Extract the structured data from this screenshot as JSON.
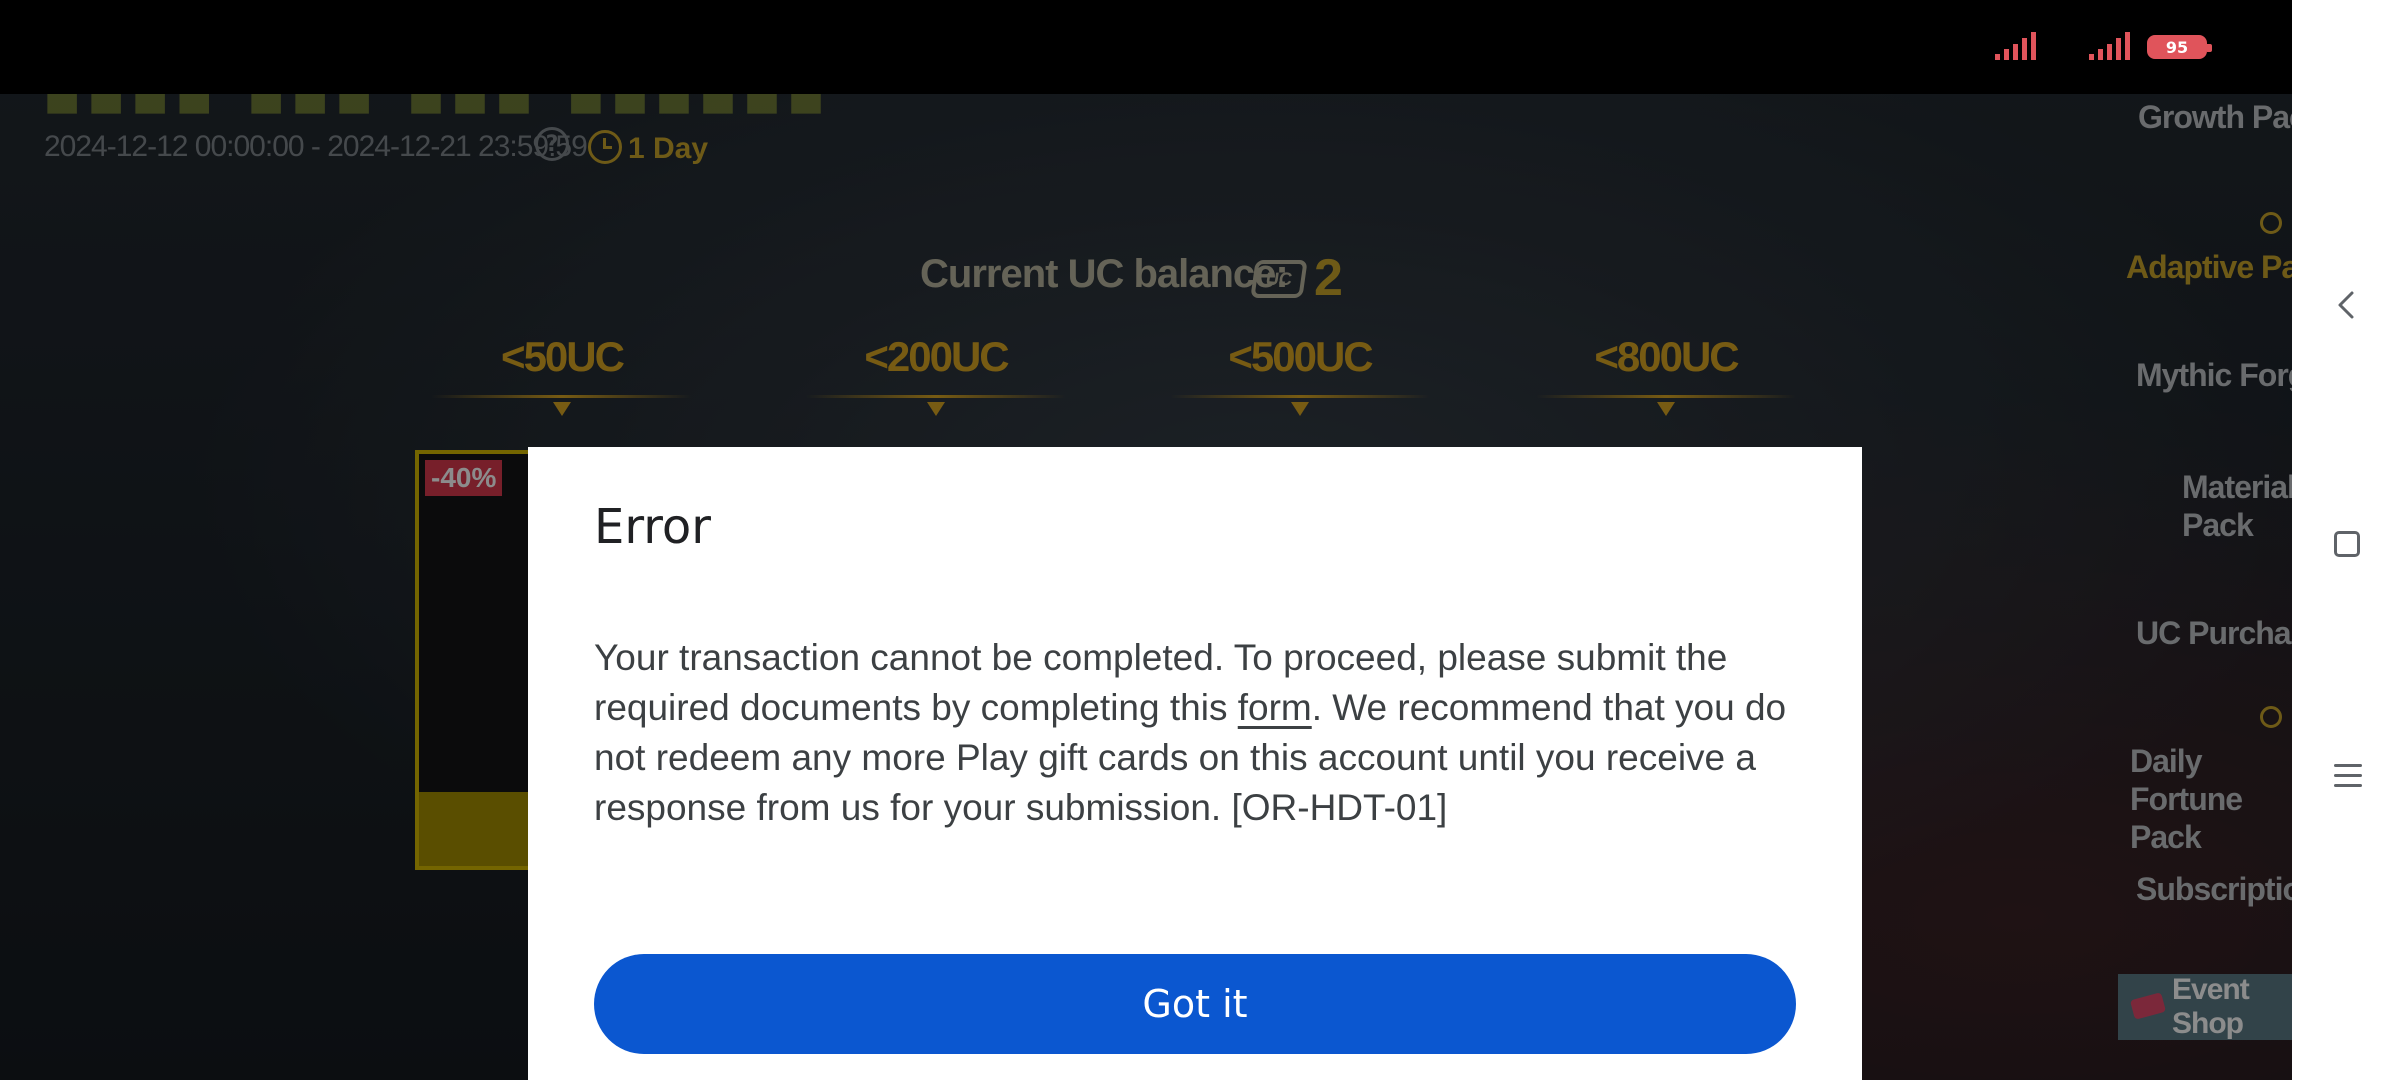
{
  "status_bar": {
    "battery": "95"
  },
  "event": {
    "dates": "2024-12-12 00:00:00 - 2024-12-21 23:59:59",
    "duration": "1 Day",
    "help_symbol": "?"
  },
  "balance": {
    "label": "Current UC balance:",
    "currency_icon": "UC",
    "value": "2"
  },
  "tiers": [
    {
      "label": "<50UC"
    },
    {
      "label": "<200UC"
    },
    {
      "label": "<500UC"
    },
    {
      "label": "<800UC"
    }
  ],
  "card": {
    "discount": "-40%"
  },
  "side_nav": {
    "items": [
      {
        "label": "Growth Pack"
      },
      {
        "label": "Adaptive Pack"
      },
      {
        "label": "Mythic Forge"
      },
      {
        "label": "Materials Pack"
      },
      {
        "label": "UC Purchase"
      },
      {
        "label": "Daily Fortune Pack"
      },
      {
        "label": "Subscription"
      }
    ],
    "event_shop": "Event Shop"
  },
  "dialog": {
    "title": "Error",
    "message_before_link": "Your transaction cannot be completed. To proceed, please submit the required documents by completing this ",
    "link_text": "form",
    "message_after_link": ". We recommend that you do not redeem any more Play gift cards on this account until you receive a response from us for your submission. [OR-HDT-01]",
    "button_label": "Got it"
  },
  "colors": {
    "primary_button": "#0b57d0",
    "game_gold": "#d9a623",
    "discount_red": "#d93a4e",
    "battery_red": "#e0545b"
  },
  "icons": [
    "signal-icon",
    "battery-icon",
    "help-icon",
    "clock-icon",
    "uc-coin-icon",
    "back-icon",
    "home-icon",
    "menu-icon",
    "ticket-icon"
  ]
}
